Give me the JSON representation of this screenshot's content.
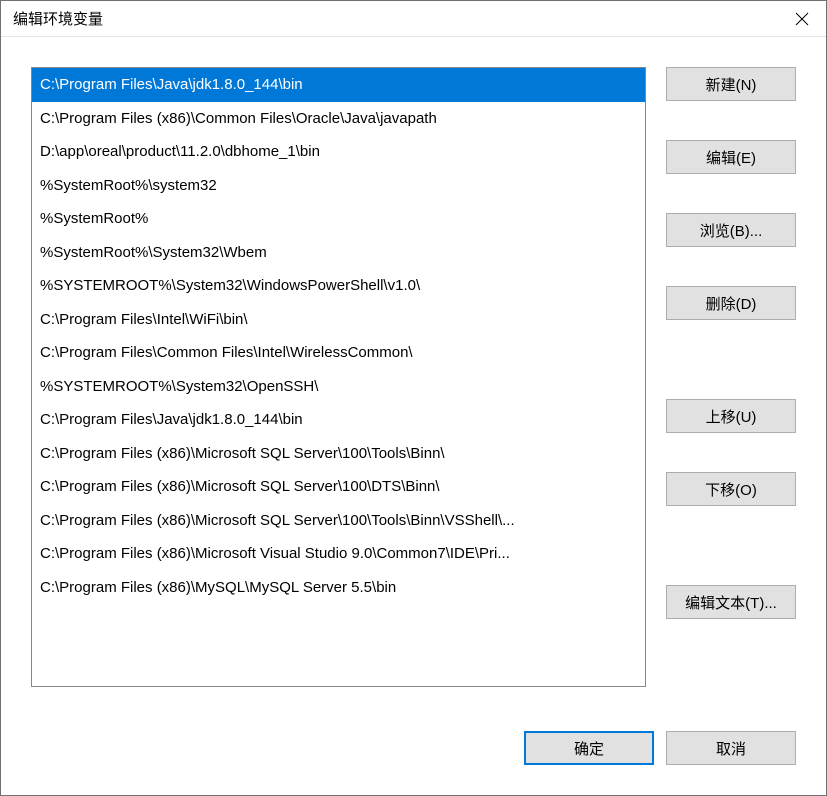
{
  "title": "编辑环境变量",
  "list": {
    "items": [
      "C:\\Program Files\\Java\\jdk1.8.0_144\\bin",
      "C:\\Program Files (x86)\\Common Files\\Oracle\\Java\\javapath",
      "D:\\app\\oreal\\product\\11.2.0\\dbhome_1\\bin",
      "%SystemRoot%\\system32",
      "%SystemRoot%",
      "%SystemRoot%\\System32\\Wbem",
      "%SYSTEMROOT%\\System32\\WindowsPowerShell\\v1.0\\",
      "C:\\Program Files\\Intel\\WiFi\\bin\\",
      "C:\\Program Files\\Common Files\\Intel\\WirelessCommon\\",
      "%SYSTEMROOT%\\System32\\OpenSSH\\",
      "C:\\Program Files\\Java\\jdk1.8.0_144\\bin",
      "C:\\Program Files (x86)\\Microsoft SQL Server\\100\\Tools\\Binn\\",
      "C:\\Program Files (x86)\\Microsoft SQL Server\\100\\DTS\\Binn\\",
      "C:\\Program Files (x86)\\Microsoft SQL Server\\100\\Tools\\Binn\\VSShell\\...",
      "C:\\Program Files (x86)\\Microsoft Visual Studio 9.0\\Common7\\IDE\\Pri...",
      "C:\\Program Files (x86)\\MySQL\\MySQL Server 5.5\\bin"
    ],
    "selectedIndex": 0
  },
  "buttons": {
    "new": "新建(N)",
    "edit": "编辑(E)",
    "browse": "浏览(B)...",
    "delete": "删除(D)",
    "moveUp": "上移(U)",
    "moveDown": "下移(O)",
    "editText": "编辑文本(T)...",
    "ok": "确定",
    "cancel": "取消"
  }
}
